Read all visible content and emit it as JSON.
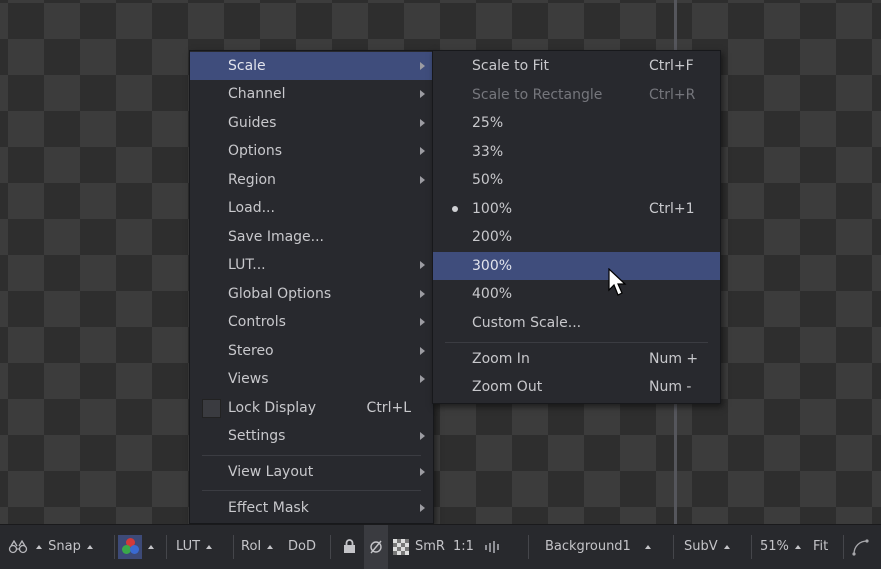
{
  "main_menu": {
    "items": [
      {
        "label": "Scale",
        "shortcut": "",
        "submenu": true
      },
      {
        "label": "Channel",
        "shortcut": "",
        "submenu": true
      },
      {
        "label": "Guides",
        "shortcut": "",
        "submenu": true
      },
      {
        "label": "Options",
        "shortcut": "",
        "submenu": true
      },
      {
        "label": "Region",
        "shortcut": "",
        "submenu": true
      },
      {
        "label": "Load...",
        "shortcut": "",
        "submenu": false
      },
      {
        "label": "Save Image...",
        "shortcut": "",
        "submenu": false
      },
      {
        "label": "LUT...",
        "shortcut": "",
        "submenu": true
      },
      {
        "label": "Global Options",
        "shortcut": "",
        "submenu": true
      },
      {
        "label": "Controls",
        "shortcut": "",
        "submenu": true
      },
      {
        "label": "Stereo",
        "shortcut": "",
        "submenu": true
      },
      {
        "label": "Views",
        "shortcut": "",
        "submenu": true
      },
      {
        "label": "Lock Display",
        "shortcut": "Ctrl+L",
        "submenu": false
      },
      {
        "label": "Settings",
        "shortcut": "",
        "submenu": true
      },
      {
        "label": "View Layout",
        "shortcut": "",
        "submenu": true
      },
      {
        "label": "Effect Mask",
        "shortcut": "",
        "submenu": true
      }
    ]
  },
  "scale_menu": {
    "items": [
      {
        "label": "Scale to Fit",
        "shortcut": "Ctrl+F"
      },
      {
        "label": "Scale to Rectangle",
        "shortcut": "Ctrl+R"
      },
      {
        "label": "25%",
        "shortcut": ""
      },
      {
        "label": "33%",
        "shortcut": ""
      },
      {
        "label": "50%",
        "shortcut": ""
      },
      {
        "label": "100%",
        "shortcut": "Ctrl+1"
      },
      {
        "label": "200%",
        "shortcut": ""
      },
      {
        "label": "300%",
        "shortcut": ""
      },
      {
        "label": "400%",
        "shortcut": ""
      },
      {
        "label": "Custom Scale...",
        "shortcut": ""
      },
      {
        "label": "Zoom In",
        "shortcut": "Num +"
      },
      {
        "label": "Zoom Out",
        "shortcut": "Num -"
      }
    ]
  },
  "toolbar": {
    "snap": "Snap",
    "lut": "LUT",
    "roi": "RoI",
    "dod": "DoD",
    "smr": "SmR",
    "ratio": "1:1",
    "view_name": "Background1",
    "subv": "SubV",
    "zoom": "51%",
    "fit": "Fit"
  },
  "colors": {
    "highlight": "#3f4d7c",
    "menu_bg": "#28292e"
  }
}
